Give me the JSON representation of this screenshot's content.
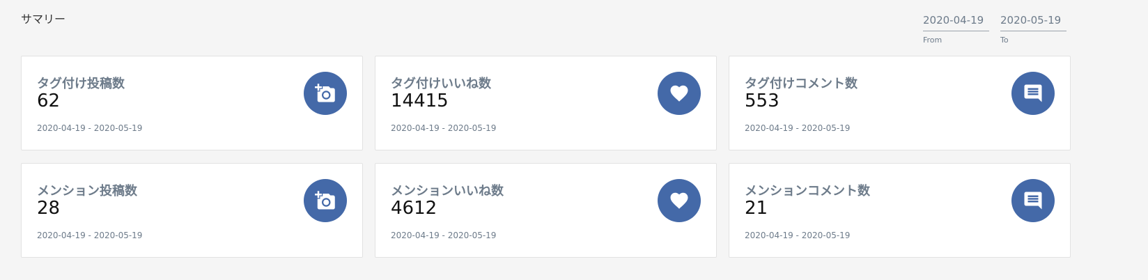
{
  "header": {
    "title": "サマリー"
  },
  "date_range": {
    "from": {
      "value": "2020-04-19",
      "label": "From"
    },
    "to": {
      "value": "2020-05-19",
      "label": "To"
    }
  },
  "cards": [
    {
      "title": "タグ付け投稿数",
      "value": "62",
      "range": "2020-04-19 - 2020-05-19",
      "icon": "add-photo-icon"
    },
    {
      "title": "タグ付けいいね数",
      "value": "14415",
      "range": "2020-04-19 - 2020-05-19",
      "icon": "heart-icon"
    },
    {
      "title": "タグ付けコメント数",
      "value": "553",
      "range": "2020-04-19 - 2020-05-19",
      "icon": "comment-icon"
    },
    {
      "title": "メンション投稿数",
      "value": "28",
      "range": "2020-04-19 - 2020-05-19",
      "icon": "add-photo-icon"
    },
    {
      "title": "メンションいいね数",
      "value": "4612",
      "range": "2020-04-19 - 2020-05-19",
      "icon": "heart-icon"
    },
    {
      "title": "メンションコメント数",
      "value": "21",
      "range": "2020-04-19 - 2020-05-19",
      "icon": "comment-icon"
    }
  ],
  "colors": {
    "accent": "#4469a8",
    "background": "#f5f5f5",
    "muted_text": "#6d7b8a"
  }
}
